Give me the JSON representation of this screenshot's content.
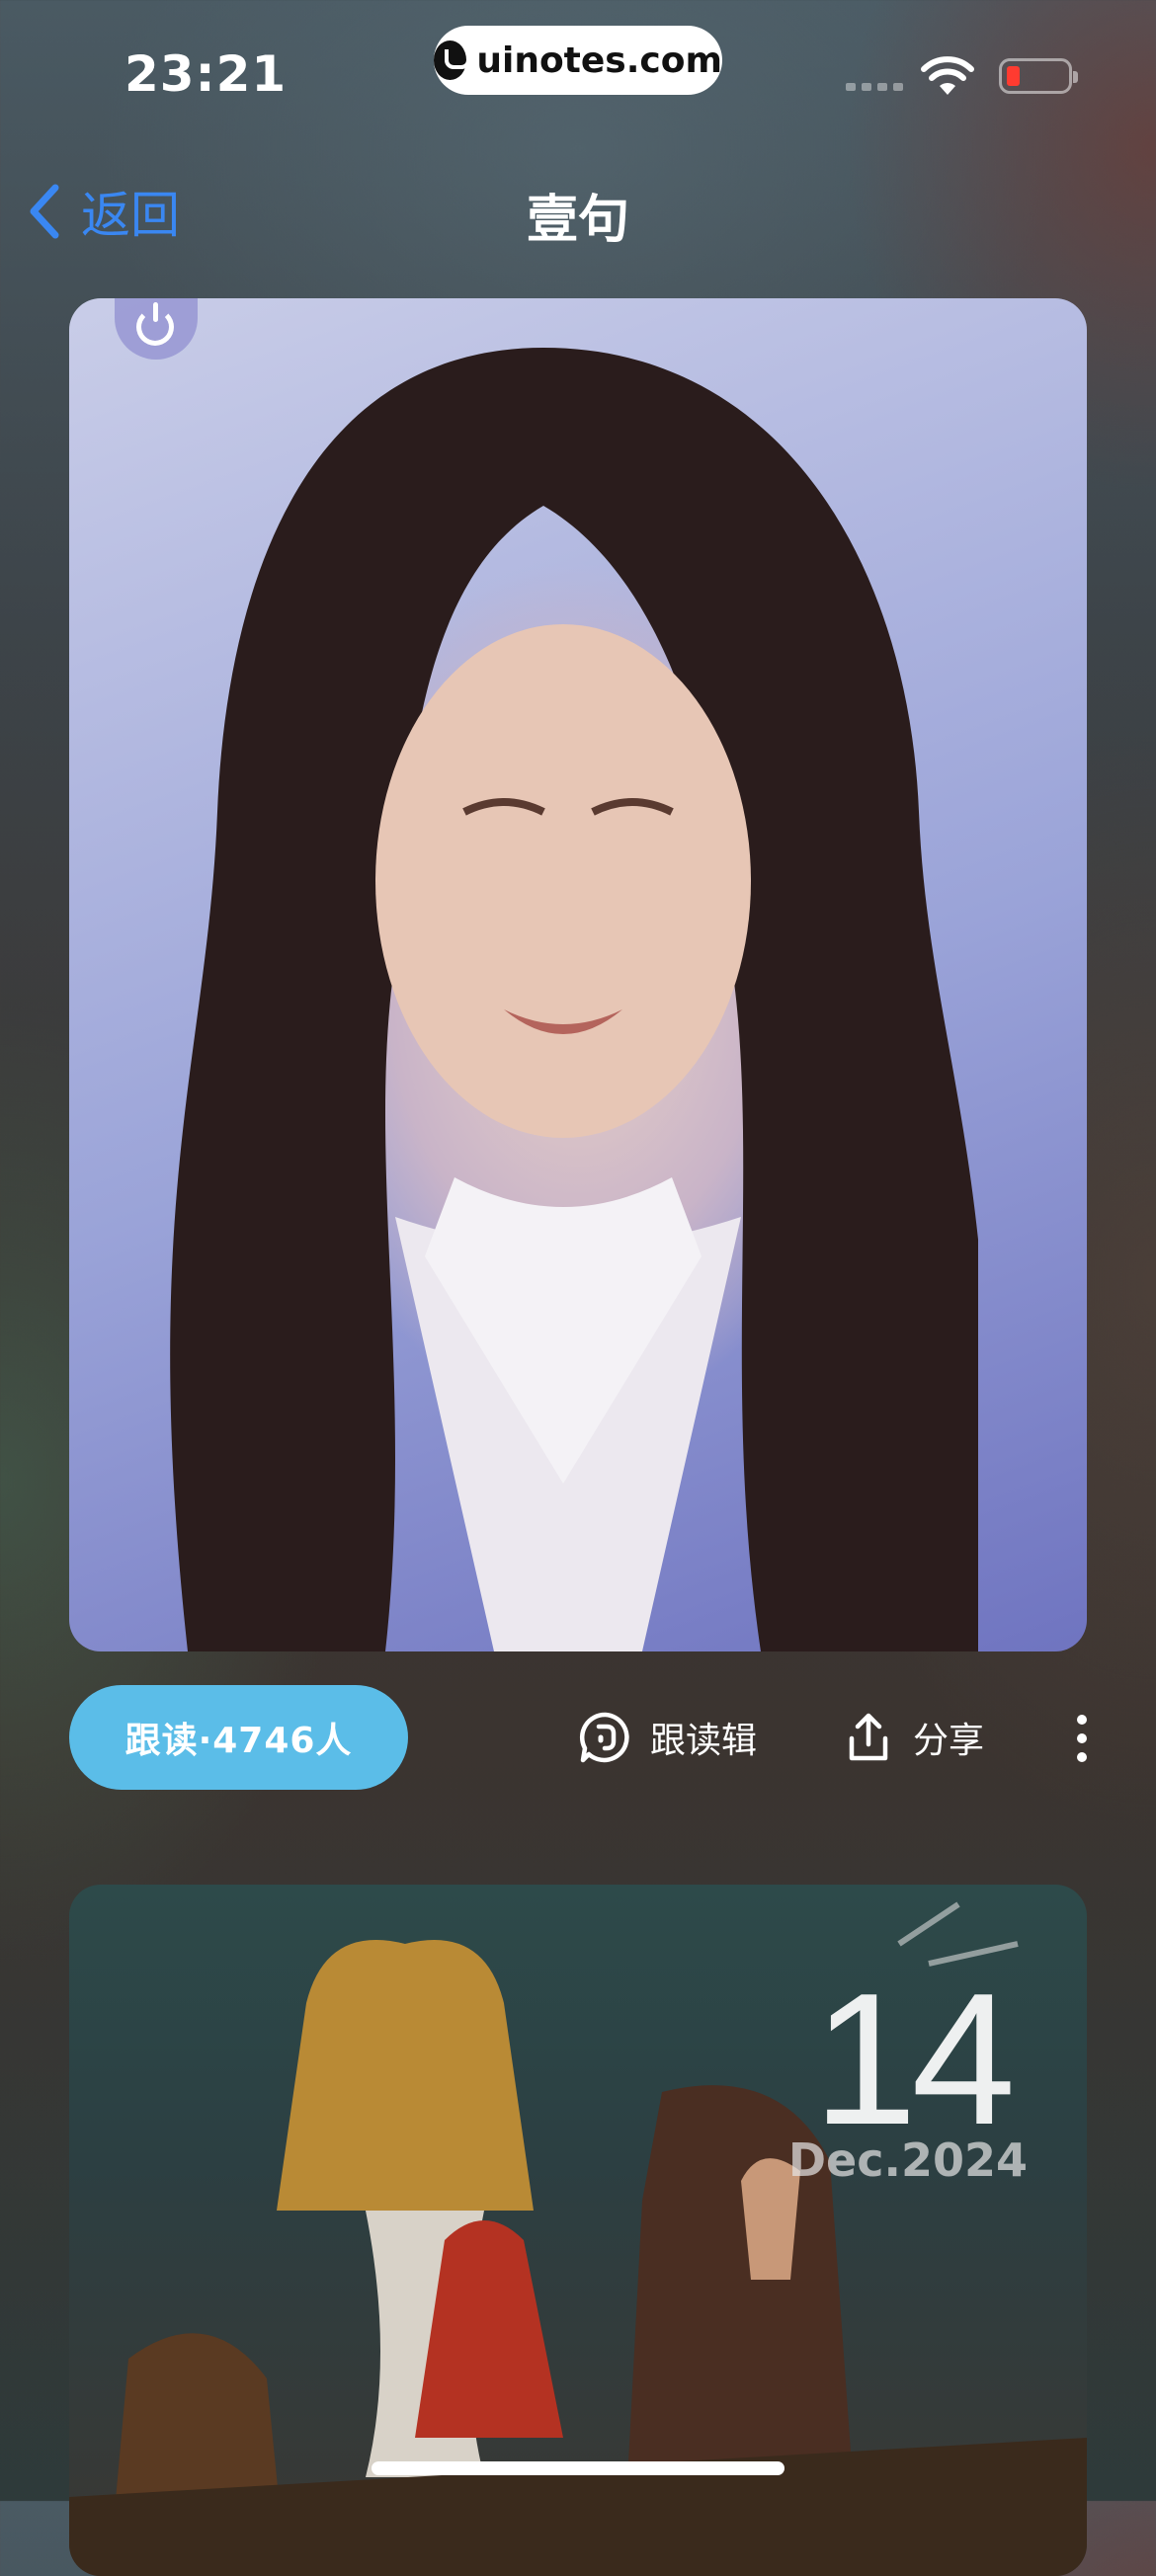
{
  "status_bar": {
    "time": "23:21",
    "url": "uinotes.com"
  },
  "nav": {
    "back_label": "返回",
    "title": "壹句"
  },
  "actions": {
    "follow_label": "跟读·4746人",
    "edit_label": "跟读辑",
    "share_label": "分享"
  },
  "card2": {
    "day": "14",
    "month_year": "Dec.2024"
  },
  "colors": {
    "accent": "#3a87f2",
    "follow_button": "#5bbde8",
    "battery_low": "#ff3b30"
  }
}
